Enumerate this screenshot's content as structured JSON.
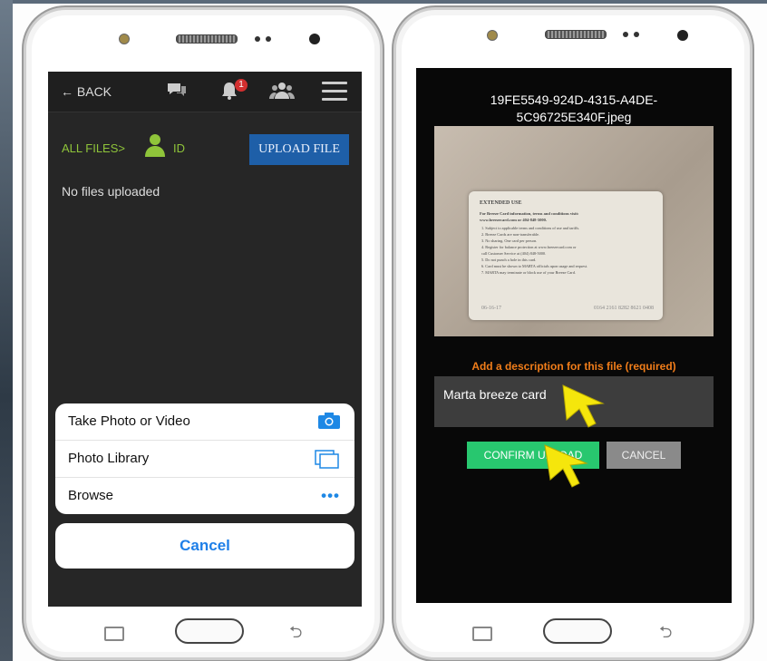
{
  "left_screen": {
    "topbar": {
      "back_label": "← BACK",
      "notification_count": "1",
      "icons": [
        "chat-icon",
        "bell-icon",
        "users-icon",
        "menu-icon"
      ]
    },
    "breadcrumb": {
      "all_files": "ALL FILES>",
      "id": "ID"
    },
    "upload_button": "UPLOAD FILE",
    "empty_message": "No files uploaded",
    "action_sheet": {
      "items": [
        {
          "label": "Take Photo or Video",
          "icon": "camera-icon"
        },
        {
          "label": "Photo Library",
          "icon": "photo-library-icon"
        },
        {
          "label": "Browse",
          "icon": "more-dots-icon"
        }
      ],
      "cancel_label": "Cancel"
    }
  },
  "right_screen": {
    "file_name_line1": "19FE5549-924D-4315-A4DE-",
    "file_name_line2": "5C96725E340F.jpeg",
    "card_text": {
      "heading": "EXTENDED USE",
      "line1": "For Breeze Card information, terms and conditions visit:",
      "line2": "www.breezecard.com or 404-848-5000.",
      "rules": [
        "1. Subject to applicable terms and conditions of use and tariffs.",
        "2. Breeze Cards are non-transferable.",
        "3. No sharing. One card per person.",
        "4. Register for balance protection at www.breezecard.com or",
        "   call Customer Service at (404) 848-5000.",
        "5. Do not punch a hole in this card.",
        "6. Card must be shown to MARTA officials upon usage and request.",
        "7. MARTA may terminate or block use of your Breeze Card."
      ],
      "date": "06-16-17",
      "serial": "0164 2161 8282 8621 0408"
    },
    "description_label": "Add a description for this file (required)",
    "description_value": "Marta breeze card",
    "confirm_label": "CONFIRM UPLOAD",
    "cancel_label": "CANCEL"
  },
  "colors": {
    "accent_green": "#8fc43a",
    "upload_blue": "#1e5fa8",
    "confirm_green": "#28c76f",
    "label_orange": "#f07d1a",
    "arrow_yellow": "#f5e60c"
  }
}
